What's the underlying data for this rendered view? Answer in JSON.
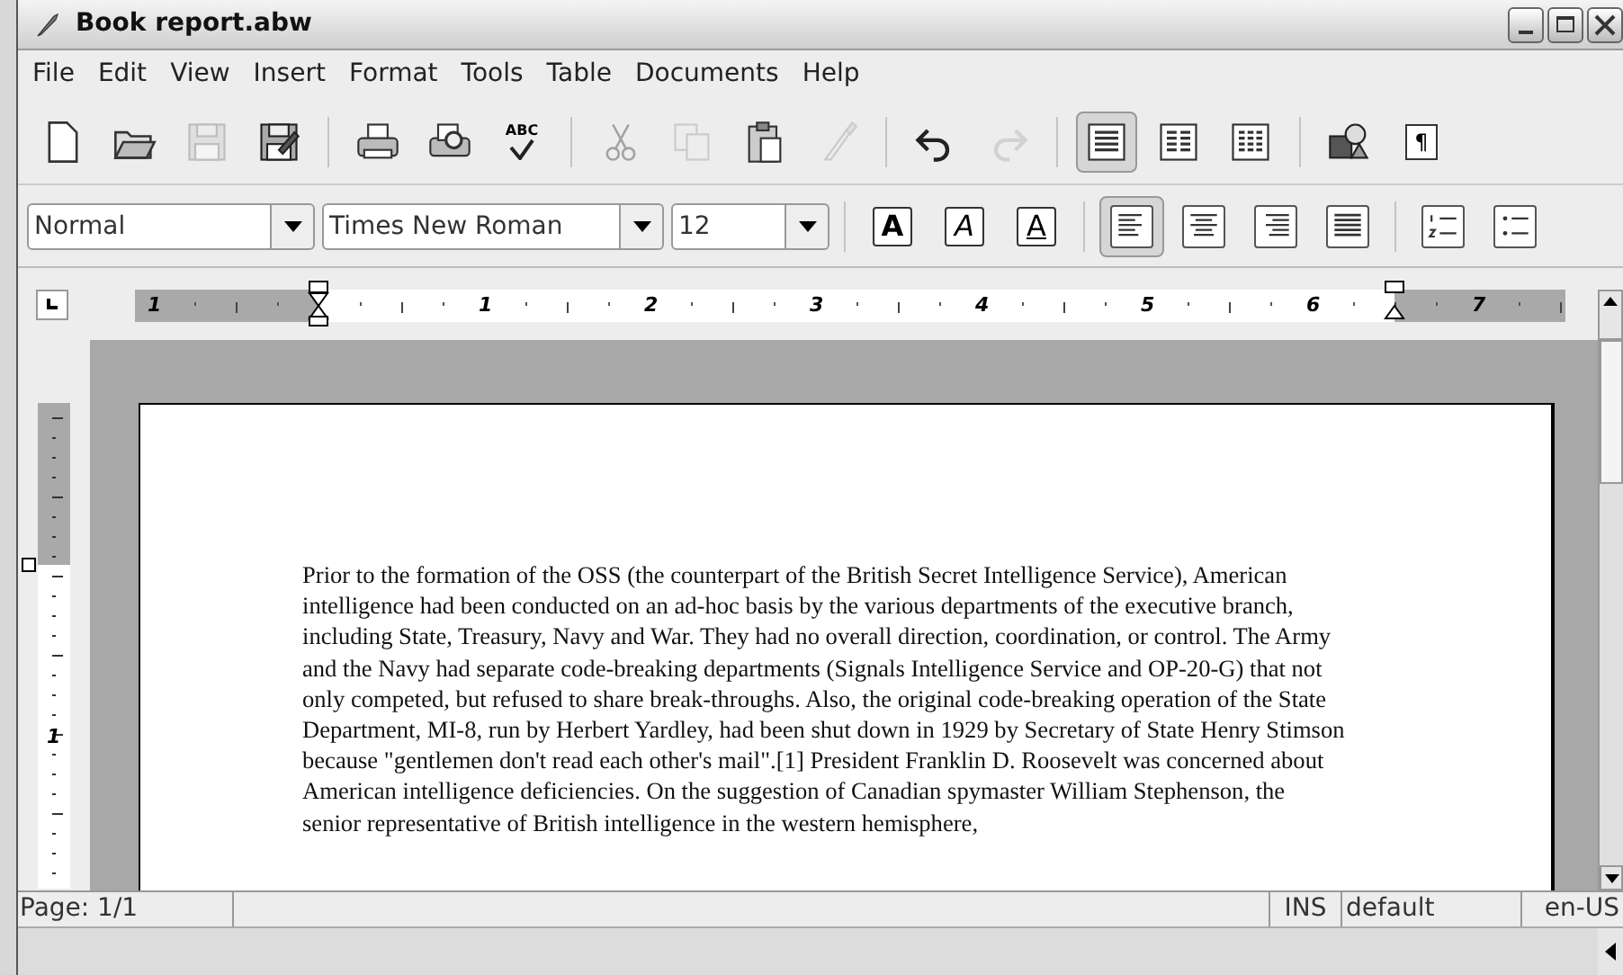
{
  "window": {
    "title": "Book report.abw"
  },
  "menu": [
    "File",
    "Edit",
    "View",
    "Insert",
    "Format",
    "Tools",
    "Table",
    "Documents",
    "Help"
  ],
  "toolbar": [
    {
      "kind": "new",
      "disabled": false
    },
    {
      "kind": "open",
      "disabled": false
    },
    {
      "kind": "save",
      "disabled": true
    },
    {
      "kind": "saveas",
      "disabled": false
    },
    {
      "kind": "sep"
    },
    {
      "kind": "print",
      "disabled": false
    },
    {
      "kind": "preview",
      "disabled": false
    },
    {
      "kind": "spell",
      "label": "ABC",
      "disabled": false
    },
    {
      "kind": "sep"
    },
    {
      "kind": "cut",
      "disabled": true
    },
    {
      "kind": "copy",
      "disabled": true
    },
    {
      "kind": "paste",
      "disabled": false
    },
    {
      "kind": "painter",
      "disabled": true
    },
    {
      "kind": "sep"
    },
    {
      "kind": "undo",
      "disabled": false
    },
    {
      "kind": "redo",
      "disabled": true
    },
    {
      "kind": "sep"
    },
    {
      "kind": "col1",
      "disabled": false,
      "selected": true
    },
    {
      "kind": "col2",
      "disabled": false,
      "selected": false
    },
    {
      "kind": "col3",
      "disabled": false,
      "selected": false
    },
    {
      "kind": "sep"
    },
    {
      "kind": "image",
      "disabled": false
    },
    {
      "kind": "pilcrow",
      "label": "¶",
      "disabled": false
    }
  ],
  "format_bar": {
    "style": "Normal",
    "font": "Times New Roman",
    "size": "12",
    "buttons": [
      {
        "kind": "bold",
        "label": "A",
        "selected": false
      },
      {
        "kind": "italic",
        "label": "A",
        "selected": false
      },
      {
        "kind": "underline",
        "label": "A",
        "selected": false
      },
      {
        "kind": "sep"
      },
      {
        "kind": "left",
        "selected": true
      },
      {
        "kind": "center",
        "selected": false
      },
      {
        "kind": "right",
        "selected": false
      },
      {
        "kind": "justify",
        "selected": false
      },
      {
        "kind": "sep"
      },
      {
        "kind": "numbered",
        "selected": false
      },
      {
        "kind": "bulleted",
        "selected": false
      }
    ]
  },
  "ruler": {
    "labels": [
      "1",
      "1",
      "2",
      "3",
      "4",
      "5",
      "6",
      "7"
    ],
    "vertical_label": "1"
  },
  "document": {
    "paragraph": "Prior to the formation of the OSS (the counterpart of the British Secret Intelligence Service), American intelligence had been conducted on an ad-hoc basis by the various departments of the executive branch, including State, Treasury, Navy and War. They had no overall direction, coordination, or control. The Army and the Navy had separate code-breaking departments (Signals Intelligence Service and OP-20-G) that not only competed, but refused to share break-throughs. Also, the original code-breaking operation of the State Department, MI-8, run by Herbert Yardley, had been shut down in 1929 by Secretary of State Henry Stimson because \"gentlemen don't read each other's mail\".[1] President Franklin D. Roosevelt was concerned about American intelligence deficiencies. On the suggestion of Canadian spymaster William Stephenson, the senior representative of British intelligence in the western hemisphere,"
  },
  "status_bar": {
    "page": "Page: 1/1",
    "mode": "INS",
    "section": "default",
    "language": "en-US"
  }
}
